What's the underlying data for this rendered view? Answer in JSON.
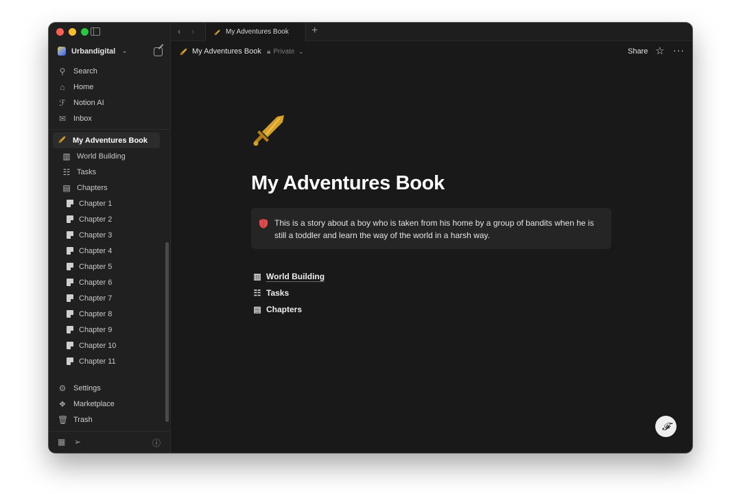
{
  "sidebar": {
    "workspace": "Urbandigital",
    "nav": [
      {
        "label": "Search",
        "icon": "search-icon"
      },
      {
        "label": "Home",
        "icon": "home-icon"
      },
      {
        "label": "Notion AI",
        "icon": "notion-ai-icon"
      },
      {
        "label": "Inbox",
        "icon": "inbox-icon"
      }
    ],
    "pages": {
      "root": "My Adventures Book",
      "world_building": "World Building",
      "tasks": "Tasks",
      "chapters": "Chapters",
      "chapter_list": [
        "Chapter 1",
        "Chapter 2",
        "Chapter 3",
        "Chapter 4",
        "Chapter 5",
        "Chapter 6",
        "Chapter 7",
        "Chapter 8",
        "Chapter 9",
        "Chapter 10",
        "Chapter 11"
      ]
    },
    "bottom": [
      {
        "label": "Settings",
        "icon": "gear-icon"
      },
      {
        "label": "Marketplace",
        "icon": "marketplace-icon"
      },
      {
        "label": "Trash",
        "icon": "trash-icon"
      }
    ]
  },
  "tab": {
    "title": "My Adventures Book"
  },
  "topbar": {
    "breadcrumb": "My Adventures Book",
    "visibility": "Private",
    "share": "Share"
  },
  "page": {
    "title": "My Adventures Book",
    "callout": "This is a story about a boy who is taken from his home by a group of bandits when he is still a toddler and learn the way of the world in a harsh way.",
    "links": [
      "World Building",
      "Tasks",
      "Chapters"
    ]
  },
  "colors": {
    "background": "#191919",
    "sidebar": "#202020",
    "accent_sword": "#d4a22c",
    "callout_icon": "#e04b4b"
  }
}
